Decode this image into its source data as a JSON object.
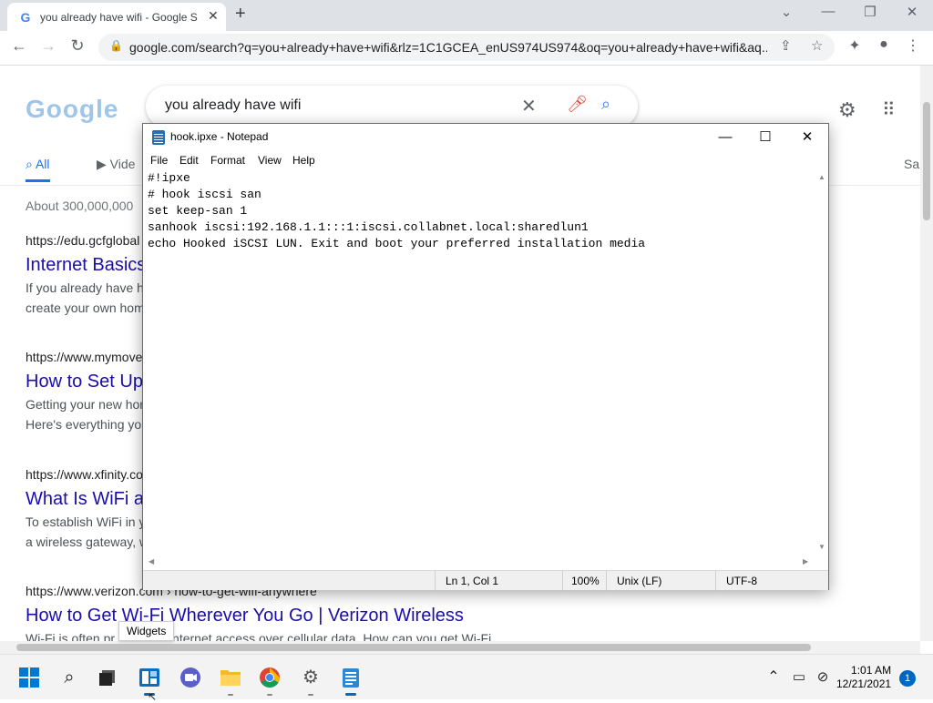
{
  "browser": {
    "tab_title": "you already have wifi - Google S",
    "favicon": "G",
    "url": "google.com/search?q=you+already+have+wifi&rlz=1C1GCEA_enUS974US974&oq=you+already+have+wifi&aq..."
  },
  "google": {
    "query": "you already have wifi",
    "tabs": {
      "all": "All",
      "videos": "Vide",
      "more": "Sa"
    },
    "stats": "About 300,000,000",
    "results": [
      {
        "cite": "https://edu.gcfglobal",
        "title": "Internet Basics",
        "snippet_1": "If you already have h",
        "snippet_2": "create your own hom"
      },
      {
        "cite": "https://www.mymove",
        "title": "How to Set Up",
        "snippet_1": "Getting your new hor",
        "snippet_2": "Here's everything you"
      },
      {
        "cite": "https://www.xfinity.co",
        "title": "What Is WiFi ar",
        "snippet_1": "To establish WiFi in y",
        "snippet_2": "a wireless gateway, w"
      },
      {
        "cite": "https://www.verizon.com › how-to-get-wifi-anywhere",
        "title": "How to Get Wi-Fi Wherever You Go | Verizon Wireless",
        "snippet_1": "Wi-Fi is often pr... mobile internet access over cellular data. How can you get Wi-Fi...",
        "snippet_2": ""
      }
    ]
  },
  "notepad": {
    "title": "hook.ipxe - Notepad",
    "menu": {
      "file": "File",
      "edit": "Edit",
      "format": "Format",
      "view": "View",
      "help": "Help"
    },
    "content": "#!ipxe\n# hook iscsi san\nset keep-san 1\nsanhook iscsi:192.168.1.1:::1:iscsi.collabnet.local:sharedlun1\necho Hooked iSCSI LUN. Exit and boot your preferred installation media",
    "status": {
      "position": "Ln 1, Col 1",
      "zoom": "100%",
      "line_ending": "Unix (LF)",
      "encoding": "UTF-8"
    }
  },
  "tooltip": "Widgets",
  "taskbar": {
    "time": "1:01 AM",
    "date": "12/21/2021",
    "notification_count": "1"
  }
}
